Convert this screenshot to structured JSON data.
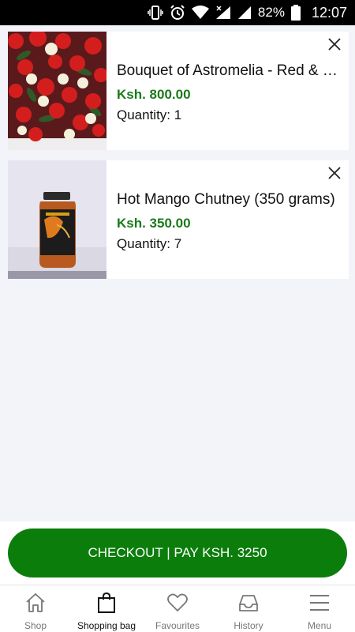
{
  "status_bar": {
    "battery": "82%",
    "time": "12:07"
  },
  "cart": {
    "items": [
      {
        "title": "Bouquet of Astromelia - Red & White",
        "price": "Ksh. 800.00",
        "quantity": "Quantity: 1",
        "image": "roses-bouquet-image"
      },
      {
        "title": "Hot Mango Chutney (350 grams)",
        "price": "Ksh. 350.00",
        "quantity": "Quantity: 7",
        "image": "chutney-jar-image"
      }
    ]
  },
  "checkout": {
    "label": "CHECKOUT | PAY KSH. 3250"
  },
  "nav": {
    "items": [
      {
        "label": "Shop",
        "icon": "home-icon"
      },
      {
        "label": "Shopping bag",
        "icon": "shopping-bag-icon"
      },
      {
        "label": "Favourites",
        "icon": "heart-icon"
      },
      {
        "label": "History",
        "icon": "inbox-icon"
      },
      {
        "label": "Menu",
        "icon": "menu-icon"
      }
    ]
  },
  "colors": {
    "accent": "#0b7d0b",
    "price": "#1a7a1a",
    "background": "#f3f4f9"
  }
}
